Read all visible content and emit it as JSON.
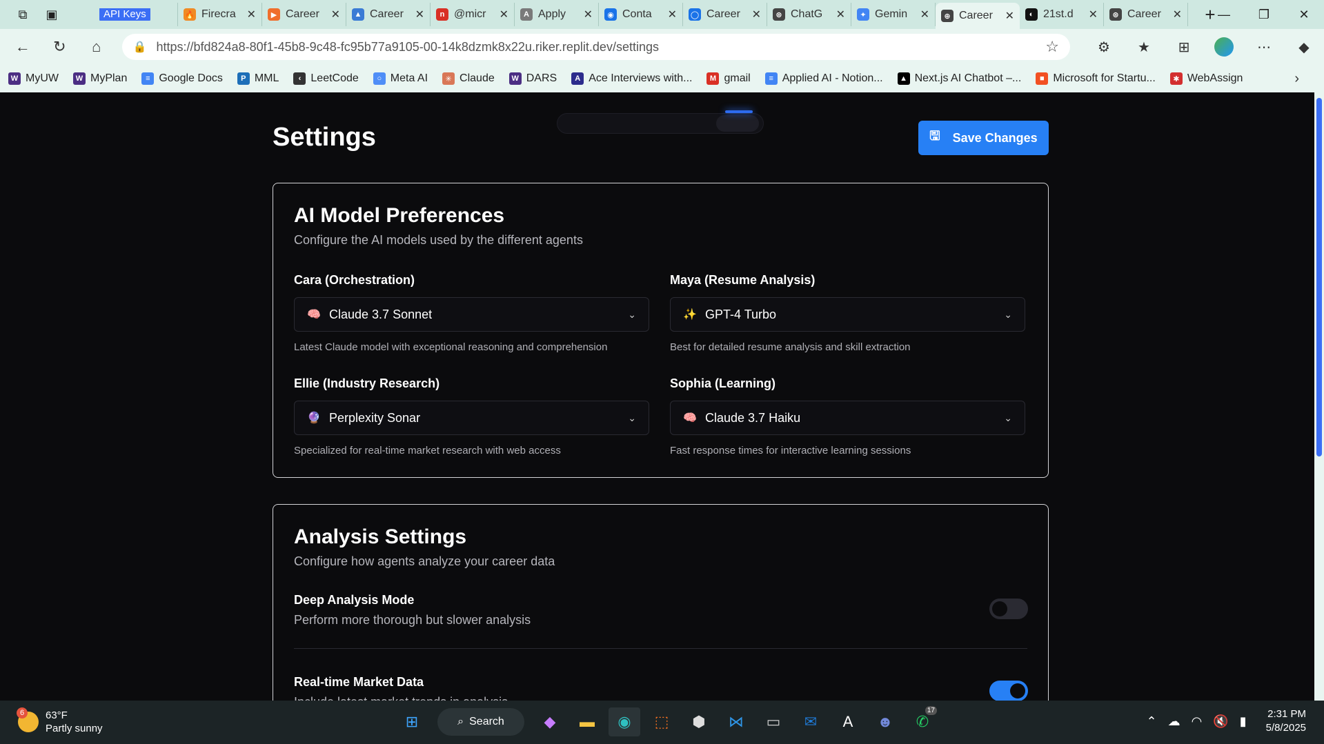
{
  "browser": {
    "tabs": [
      {
        "label": "API Keys",
        "color": "#3b6ef5",
        "glyph": "K"
      },
      {
        "label": "Firecra",
        "color": "#f08a24",
        "glyph": "🔥"
      },
      {
        "label": "Career",
        "color": "#f06e2c",
        "glyph": "▶"
      },
      {
        "label": "Career",
        "color": "#3a7bd5",
        "glyph": "▲"
      },
      {
        "label": "@micr",
        "color": "#d93025",
        "glyph": "n"
      },
      {
        "label": "Apply",
        "color": "#7a7a7a",
        "glyph": "A"
      },
      {
        "label": "Conta",
        "color": "#1a73e8",
        "glyph": "◉"
      },
      {
        "label": "Career",
        "color": "#1a73e8",
        "glyph": "◯"
      },
      {
        "label": "ChatG",
        "color": "#444444",
        "glyph": "⊛"
      },
      {
        "label": "Gemin",
        "color": "#4285f4",
        "glyph": "✦"
      },
      {
        "label": "Career",
        "color": "#444444",
        "glyph": "⊕"
      },
      {
        "label": "21st.d",
        "color": "#111111",
        "glyph": "◐"
      },
      {
        "label": "Career",
        "color": "#444444",
        "glyph": "⊛"
      }
    ],
    "url": "https://bfd824a8-80f1-45b8-9c48-fc95b77a9105-00-14k8dzmk8x22u.riker.replit.dev/settings",
    "bookmarks": [
      {
        "label": "MyUW",
        "color": "#4b2e83",
        "glyph": "W"
      },
      {
        "label": "MyPlan",
        "color": "#4b2e83",
        "glyph": "W"
      },
      {
        "label": "Google Docs",
        "color": "#4285f4",
        "glyph": "≡"
      },
      {
        "label": "MML",
        "color": "#1d6fb8",
        "glyph": "P"
      },
      {
        "label": "LeetCode",
        "color": "#333333",
        "glyph": "‹"
      },
      {
        "label": "Meta AI",
        "color": "#4f8ef7",
        "glyph": "○"
      },
      {
        "label": "Claude",
        "color": "#d97757",
        "glyph": "✳"
      },
      {
        "label": "DARS",
        "color": "#4b2e83",
        "glyph": "W"
      },
      {
        "label": "Ace Interviews with...",
        "color": "#2c2c8c",
        "glyph": "A"
      },
      {
        "label": "gmail",
        "color": "#d93025",
        "glyph": "M"
      },
      {
        "label": "Applied AI - Notion...",
        "color": "#4285f4",
        "glyph": "≡"
      },
      {
        "label": "Next.js AI Chatbot –...",
        "color": "#000000",
        "glyph": "▲"
      },
      {
        "label": "Microsoft for Startu...",
        "color": "#f25022",
        "glyph": "■"
      },
      {
        "label": "WebAssign",
        "color": "#d32f2f",
        "glyph": "✱"
      }
    ]
  },
  "page": {
    "title": "Settings",
    "save_label": "Save Changes",
    "ai_models": {
      "heading": "AI Model Preferences",
      "subheading": "Configure the AI models used by the different agents",
      "fields": [
        {
          "label": "Cara (Orchestration)",
          "value": "Claude 3.7 Sonnet",
          "icon": "🧠",
          "hint": "Latest Claude model with exceptional reasoning and comprehension"
        },
        {
          "label": "Maya (Resume Analysis)",
          "value": "GPT-4 Turbo",
          "icon": "✨",
          "hint": "Best for detailed resume analysis and skill extraction"
        },
        {
          "label": "Ellie (Industry Research)",
          "value": "Perplexity Sonar",
          "icon": "🔮",
          "hint": "Specialized for real-time market research with web access"
        },
        {
          "label": "Sophia (Learning)",
          "value": "Claude 3.7 Haiku",
          "icon": "🧠",
          "hint": "Fast response times for interactive learning sessions"
        }
      ]
    },
    "analysis": {
      "heading": "Analysis Settings",
      "subheading": "Configure how agents analyze your career data",
      "settings": [
        {
          "title": "Deep Analysis Mode",
          "desc": "Perform more thorough but slower analysis",
          "enabled": false
        },
        {
          "title": "Real-time Market Data",
          "desc": "Include latest market trends in analysis",
          "enabled": true
        }
      ]
    }
  },
  "taskbar": {
    "weather_temp": "63°F",
    "weather_desc": "Partly sunny",
    "weather_badge": "6",
    "search_label": "Search",
    "whatsapp_badge": "17",
    "time": "2:31 PM",
    "date": "5/8/2025"
  }
}
